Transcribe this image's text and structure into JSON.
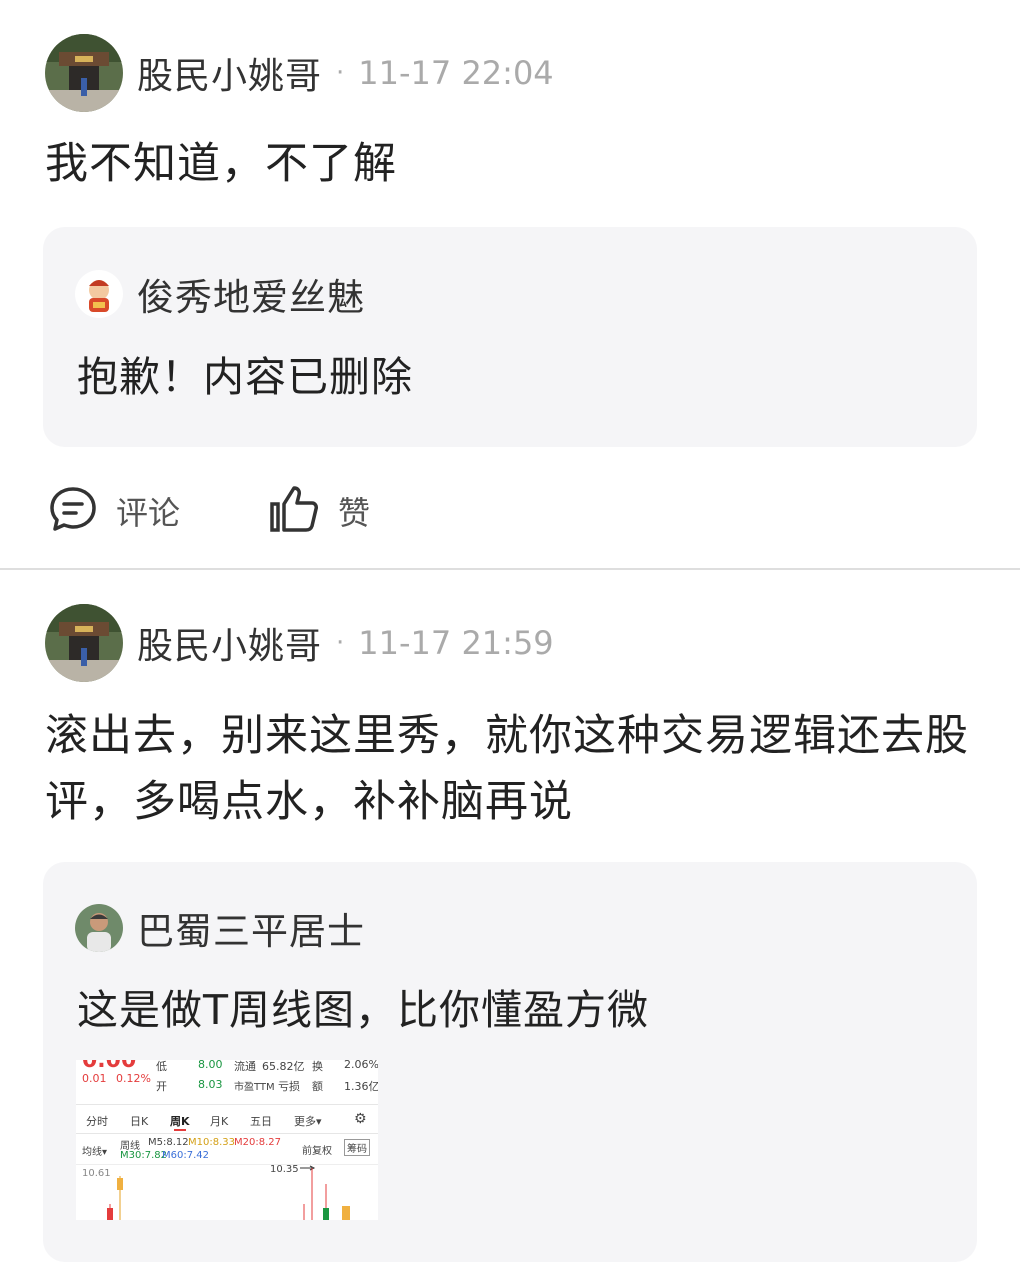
{
  "posts": [
    {
      "author": "股民小姚哥",
      "separator": "·",
      "time": "11-17 22:04",
      "text": "我不知道，不了解",
      "quoted": {
        "author": "俊秀地爱丝魅",
        "text": "抱歉！内容已删除"
      },
      "actions": {
        "comment": "评论",
        "like": "赞"
      }
    },
    {
      "author": "股民小姚哥",
      "separator": "·",
      "time": "11-17 21:59",
      "text": "滚出去，别来这里秀，就你这种交易逻辑还去股评，多喝点水，补补脑再说",
      "quoted": {
        "author": "巴蜀三平居士",
        "text": "这是做T周线图，比你懂盈方微",
        "image": {
          "row1": {
            "change": "0.01",
            "pct": "0.12%",
            "low_label": "低",
            "low": "8.00",
            "float_label": "流通",
            "float": "65.82亿",
            "turn_label": "换",
            "turn": "2.06%"
          },
          "row2": {
            "open_label": "开",
            "open": "8.03",
            "pe_label": "市盈TTM",
            "pe": "亏损",
            "amt_label": "额",
            "amt": "1.36亿"
          },
          "tabs": [
            "分时",
            "日K",
            "周K",
            "月K",
            "五日",
            "更多▾"
          ],
          "ma_select": "均线▾",
          "period": "周线",
          "ma5": "M5:8.12",
          "ma10": "M10:8.33",
          "ma20": "M20:8.27",
          "ma30": "M30:7.82",
          "ma60": "M60:7.42",
          "adjust": "前复权",
          "chip": "筹码",
          "price_high": "10.61",
          "peak_label": "10.35"
        }
      }
    }
  ],
  "colors": {
    "up": "#e43c3c",
    "down": "#1a9641",
    "quote_bg": "#f5f5f7"
  }
}
